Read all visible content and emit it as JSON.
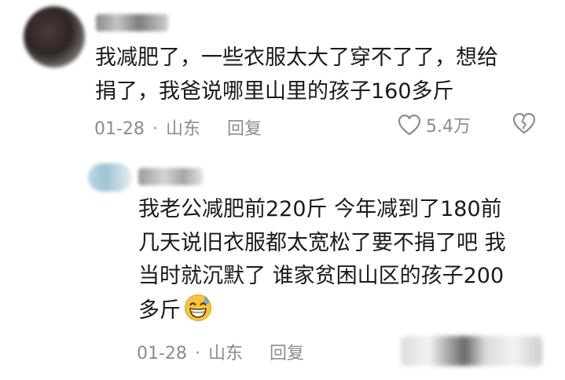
{
  "comments": [
    {
      "lines": [
        "我减肥了，一些衣服太大了穿不了了，想给",
        "捐了，我爸说哪里山里的孩子160多斤"
      ],
      "date": "01-28",
      "separator": "·",
      "location": "山东",
      "reply_label": "回复",
      "likes": "5.4万",
      "icons": {
        "like": "heart-icon",
        "dislike": "broken-heart-icon"
      }
    },
    {
      "lines": [
        "我老公减肥前220斤 今年减到了180前",
        "几天说旧衣服都太宽松了要不捐了吧 我",
        "当时就沉默了 谁家贫困山区的孩子200",
        "多斤"
      ],
      "emoji": "grinning-sweat-emoji",
      "date": "01-28",
      "separator": "·",
      "location": "山东",
      "reply_label": "回复"
    }
  ],
  "colors": {
    "text": "#1a1a1a",
    "meta": "#8c8c8c",
    "emoji_face": "#f7c53b"
  }
}
